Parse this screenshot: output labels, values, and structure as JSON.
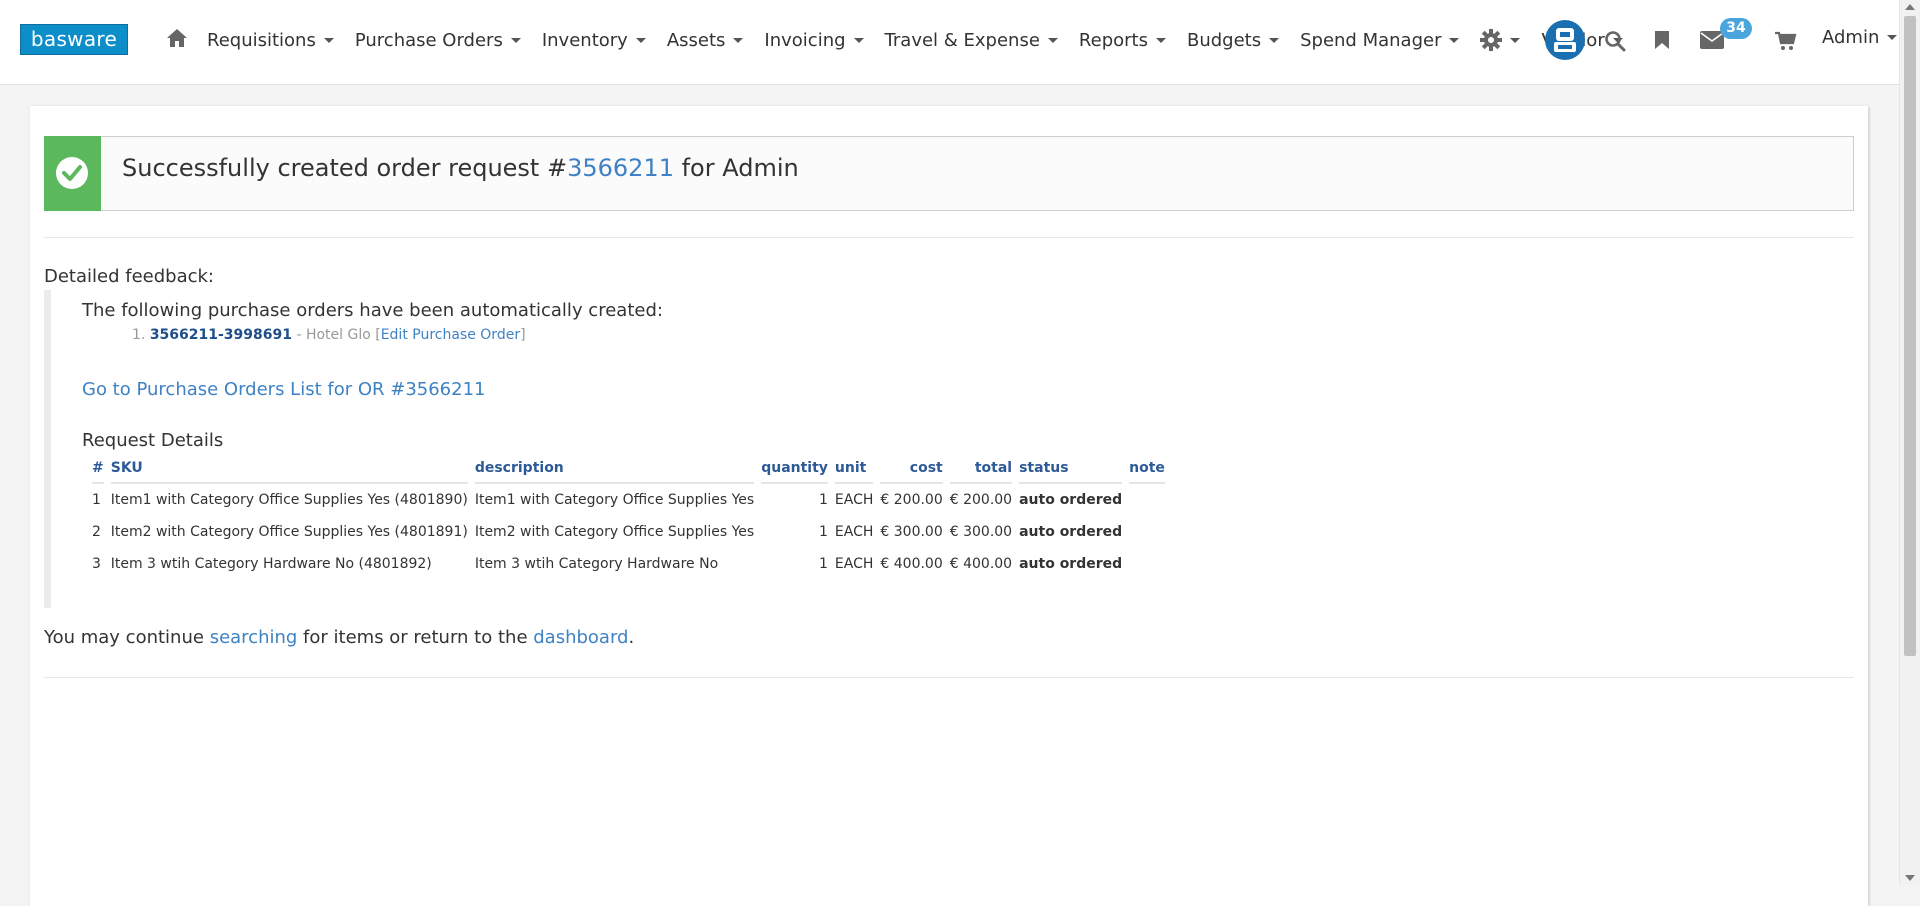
{
  "nav": {
    "logo": "basware",
    "items": [
      "Requisitions",
      "Purchase Orders",
      "Inventory",
      "Assets",
      "Invoicing",
      "Travel & Expense",
      "Reports",
      "Budgets",
      "Spend Manager"
    ],
    "vendor": "Vendor",
    "message_count": "34",
    "user": "Admin"
  },
  "alert": {
    "prefix": "Successfully created order request #",
    "order_number": "3566211",
    "suffix": " for Admin",
    "accent": "#5cb85c"
  },
  "feedback": {
    "title": "Detailed feedback:",
    "auto_text": "The following purchase orders have been automatically created:",
    "po_index": "1.",
    "po_number": "3566211-3998691",
    "po_vendor": " - Hotel Glo [",
    "po_edit": "Edit Purchase Order",
    "po_close": "]",
    "goto_link": "Go to Purchase Orders List for OR #3566211"
  },
  "request": {
    "title": "Request Details",
    "columns": {
      "num": "#",
      "sku": "SKU",
      "description": "description",
      "quantity": "quantity",
      "unit": "unit",
      "cost": "cost",
      "total": "total",
      "status": "status",
      "note": "note"
    },
    "rows": [
      {
        "num": "1",
        "sku": "Item1 with Category Office Supplies Yes (4801890)",
        "description": "Item1 with Category Office Supplies Yes",
        "quantity": "1",
        "unit": "EACH",
        "cost": "€ 200.00",
        "total": "€ 200.00",
        "status": "auto ordered",
        "note": ""
      },
      {
        "num": "2",
        "sku": "Item2 with Category Office Supplies Yes (4801891)",
        "description": "Item2 with Category Office Supplies Yes",
        "quantity": "1",
        "unit": "EACH",
        "cost": "€ 300.00",
        "total": "€ 300.00",
        "status": "auto ordered",
        "note": ""
      },
      {
        "num": "3",
        "sku": "Item 3 wtih Category Hardware No (4801892)",
        "description": "Item 3 wtih Category Hardware No",
        "quantity": "1",
        "unit": "EACH",
        "cost": "€ 400.00",
        "total": "€ 400.00",
        "status": "auto ordered",
        "note": ""
      }
    ]
  },
  "continue": {
    "prefix": "You may continue ",
    "search_link": "searching",
    "middle": " for items or return to the ",
    "dashboard_link": "dashboard",
    "suffix": "."
  },
  "icons": {
    "home": "home-icon",
    "gear": "gear-icon",
    "robot": "robot-icon",
    "search": "search-icon",
    "bookmark": "bookmark-icon",
    "envelope": "envelope-icon",
    "cart": "cart-icon",
    "check": "check-icon"
  }
}
